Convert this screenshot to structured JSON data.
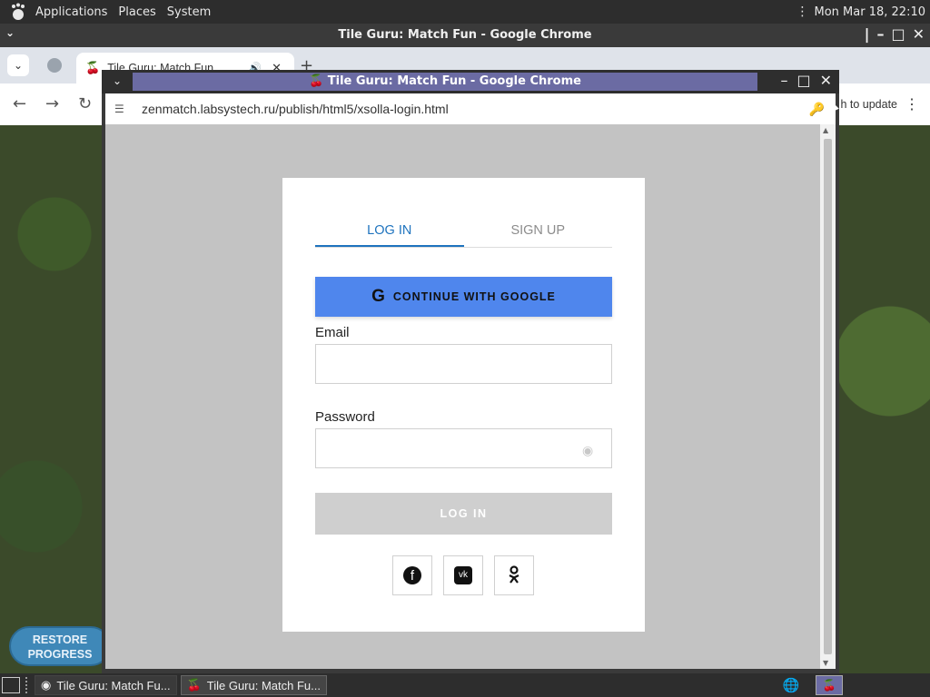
{
  "top_panel": {
    "applications_label": "Applications",
    "places_label": "Places",
    "system_label": "System",
    "clock": "Mon Mar 18, 22:10",
    "icons": {
      "logo": "gnome-foot-icon",
      "menu": "vertical-dots-icon"
    }
  },
  "background_window": {
    "title": "Tile Guru: Match Fun - Google Chrome",
    "tab": {
      "title": "Tile Guru: Match Fun",
      "favicon": "cherry-icon"
    },
    "update_label": "h to update",
    "restore_button": "RESTORE PROGRESS"
  },
  "popup": {
    "title": "Tile Guru: Match Fun - Google Chrome",
    "url": "zenmatch.labsystech.ru/publish/html5/xsolla-login.html",
    "colors": {
      "title_bar_active": "#6b6ba3",
      "overlay": "#c3c3c3"
    }
  },
  "login": {
    "tabs": [
      {
        "label": "LOG IN",
        "active": true
      },
      {
        "label": "SIGN UP",
        "active": false
      }
    ],
    "google_button": "CONTINUE WITH GOOGLE",
    "email_label": "Email",
    "email_value": "",
    "password_label": "Password",
    "password_value": "",
    "login_button": "LOG IN",
    "social_icons": [
      "facebook-icon",
      "vk-icon",
      "odnoklassniki-icon"
    ],
    "colors": {
      "accent": "#1e73be",
      "google_button": "#4f86ed",
      "disabled_button": "#cfcfcf"
    }
  },
  "taskbar": {
    "tasks": [
      {
        "label": "Tile Guru: Match Fu...",
        "icon": "chrome-icon",
        "active": false
      },
      {
        "label": "Tile Guru: Match Fu...",
        "icon": "cherry-icon",
        "active": true
      }
    ]
  }
}
